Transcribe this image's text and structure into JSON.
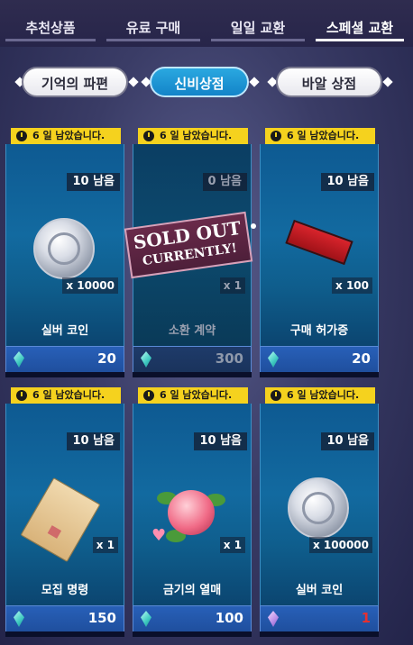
{
  "tabs": [
    "추천상품",
    "유료 구매",
    "일일 교환",
    "스페셜 교환"
  ],
  "active_tab": 3,
  "subtabs": [
    "기억의 파편",
    "신비상점",
    "바알 상점"
  ],
  "active_subtab": 1,
  "colors": {
    "active_tab_underline": "#ffffff",
    "timer_badge": "#f5d21e",
    "subtab_active": "#1d95d6",
    "limited_price": "#e63030"
  },
  "items": [
    {
      "timer": "6 일 남았습니다.",
      "remaining": "10 남음",
      "quantity": "x 10000",
      "name": "실버 코인",
      "price": "20",
      "currency_icon": "teal-gem-icon",
      "image": "silver-coin",
      "sold_out": false
    },
    {
      "timer": "6 일 남았습니다.",
      "remaining": "0 남음",
      "quantity": "x 1",
      "name": "소환 계약",
      "price": "300",
      "currency_icon": "teal-gem-icon",
      "image": "summon-contract",
      "sold_out": true,
      "sold_out_line1": "SOLD OUT",
      "sold_out_line2": "CURRENTLY!"
    },
    {
      "timer": "6 일 남았습니다.",
      "remaining": "10 남음",
      "quantity": "x 100",
      "name": "구매 허가증",
      "price": "20",
      "currency_icon": "teal-gem-icon",
      "image": "purchase-permit",
      "sold_out": false
    },
    {
      "timer": "6 일 남았습니다.",
      "remaining": "10 남음",
      "quantity": "x 1",
      "name": "모집 명령",
      "price": "150",
      "currency_icon": "teal-gem-icon",
      "image": "recruit-order-envelope",
      "sold_out": false
    },
    {
      "timer": "6 일 남았습니다.",
      "remaining": "10 남음",
      "quantity": "x 1",
      "name": "금기의 열매",
      "price": "100",
      "currency_icon": "teal-gem-icon",
      "image": "forbidden-fruit",
      "sold_out": false
    },
    {
      "timer": "6 일 남았습니다.",
      "remaining": "10 남음",
      "quantity": "x 100000",
      "name": "실버 코인",
      "price": "1",
      "currency_icon": "purple-gem-icon",
      "image": "silver-coin",
      "sold_out": false
    }
  ]
}
